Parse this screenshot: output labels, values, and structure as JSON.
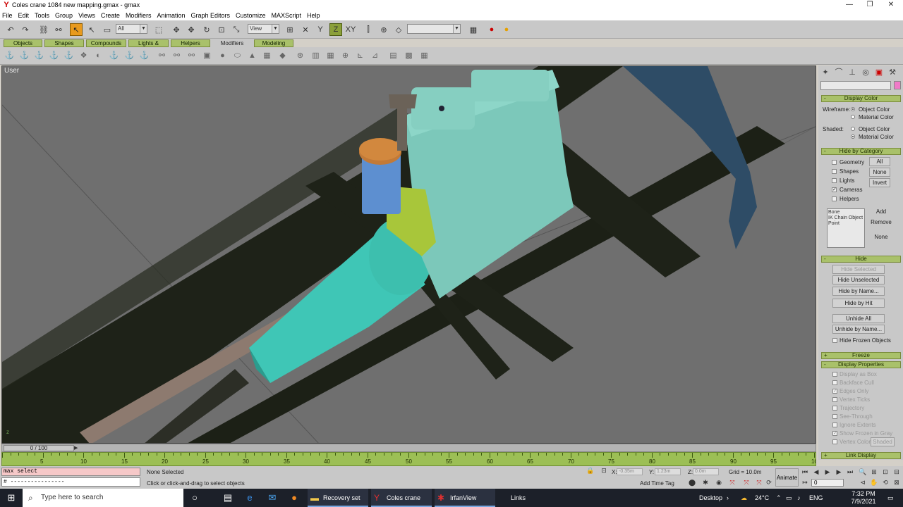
{
  "window": {
    "title": "Coles crane 1084 new mapping.gmax - gmax",
    "minimize": "—",
    "maximize": "❐",
    "close": "✕"
  },
  "menu": [
    "File",
    "Edit",
    "Tools",
    "Group",
    "Views",
    "Create",
    "Modifiers",
    "Animation",
    "Graph Editors",
    "Customize",
    "MAXScript",
    "Help"
  ],
  "toolbar": {
    "selection_filter": "All",
    "reference_coord": "View",
    "named_selection": ""
  },
  "tabs": [
    "Objects",
    "Shapes",
    "Compounds",
    "Lights & Cameras",
    "Helpers",
    "Modifiers",
    "Modeling"
  ],
  "tabs_selected": "Modifiers",
  "viewport": {
    "label": "User"
  },
  "command_panel": {
    "display_color": {
      "header": "Display Color",
      "wireframe_label": "Wireframe:",
      "shaded_label": "Shaded:",
      "object_color": "Object Color",
      "material_color": "Material Color"
    },
    "hide_by_category": {
      "header": "Hide by Category",
      "items": [
        {
          "label": "Geometry",
          "checked": false
        },
        {
          "label": "Shapes",
          "checked": false
        },
        {
          "label": "Lights",
          "checked": false
        },
        {
          "label": "Cameras",
          "checked": true
        },
        {
          "label": "Helpers",
          "checked": false
        }
      ],
      "buttons": [
        "All",
        "None",
        "Invert"
      ],
      "list": [
        "Bone",
        "IK Chain Object",
        "Point"
      ],
      "list_buttons": [
        "Add",
        "Remove",
        "None"
      ]
    },
    "hide": {
      "header": "Hide",
      "buttons": [
        "Hide Selected",
        "Hide Unselected",
        "Hide by Name...",
        "Hide by Hit",
        "Unhide All",
        "Unhide by Name..."
      ],
      "hide_frozen": "Hide Frozen Objects"
    },
    "freeze": {
      "header": "Freeze"
    },
    "display_properties": {
      "header": "Display Properties",
      "items": [
        {
          "label": "Display as Box",
          "checked": false
        },
        {
          "label": "Backface Cull",
          "checked": false
        },
        {
          "label": "Edges Only",
          "checked": true
        },
        {
          "label": "Vertex Ticks",
          "checked": false
        },
        {
          "label": "Trajectory",
          "checked": false
        },
        {
          "label": "See-Through",
          "checked": false
        },
        {
          "label": "Ignore Extents",
          "checked": false
        },
        {
          "label": "Show Frozen in Gray",
          "checked": true
        },
        {
          "label": "Vertex Colors",
          "checked": false
        }
      ],
      "shaded_button": "Shaded"
    },
    "link_display": {
      "header": "Link Display"
    }
  },
  "timeslider": {
    "value": "0 / 100",
    "current": 0,
    "total": 100
  },
  "timeline": {
    "ticks": [
      5,
      10,
      15,
      20,
      25,
      30,
      35,
      40,
      45,
      50,
      55,
      60,
      65,
      70,
      75,
      80,
      85,
      90,
      95,
      100
    ]
  },
  "status": {
    "maxscript_listener": "max select",
    "maxscript_input": "# ----------------",
    "selection": "None Selected",
    "prompt": "Click or click-and-drag to select objects",
    "x_label": "X:",
    "x_value": "-0.35m",
    "y_label": "Y:",
    "y_value": "1.23m",
    "z_label": "Z:",
    "z_value": "0.0m",
    "grid": "Grid = 10.0m",
    "add_time_tag": "Add Time Tag",
    "animate": "Animate",
    "frame": "0"
  },
  "taskbar": {
    "search_placeholder": "Type here to search",
    "apps": [
      {
        "label": "Recovery set",
        "icon": "folder-icon"
      },
      {
        "label": "Coles crane 10...",
        "icon": "gmax-icon"
      },
      {
        "label": "IrfanView",
        "icon": "irfanview-icon"
      },
      {
        "label": "Links",
        "icon": ""
      }
    ],
    "desktop": "Desktop",
    "temperature": "24°C",
    "lang": "ENG",
    "time": "7:32 PM",
    "date": "7/9/2021"
  }
}
